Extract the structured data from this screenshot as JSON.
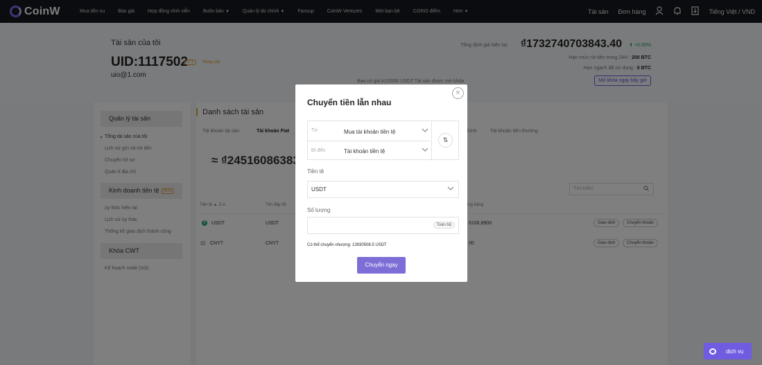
{
  "brand": {
    "name": "CoinW"
  },
  "nav": {
    "items": [
      {
        "label": "Mua tiền xu",
        "caret": false
      },
      {
        "label": "Báo giá",
        "caret": false
      },
      {
        "label": "Hợp đồng vĩnh viễn",
        "caret": false
      },
      {
        "label": "Buôn bán",
        "caret": true
      },
      {
        "label": "Quản lý tài chính",
        "caret": true
      },
      {
        "label": "Fansup",
        "caret": false
      },
      {
        "label": "CoinW Ventures",
        "caret": false
      },
      {
        "label": "Mời bạn bè",
        "caret": false
      },
      {
        "label": "COINS điểm",
        "caret": false
      },
      {
        "label": "Hơn",
        "caret": true
      }
    ],
    "right": {
      "assets": "Tài sản",
      "orders": "Đơn hàng",
      "language": "Tiếng Việt / VND"
    }
  },
  "header": {
    "title": "Tài sản của tôi",
    "uid": "UID:1117502",
    "vip": "V 1",
    "upgrade": "Nâng cấp",
    "email": "uio@1.com",
    "total_label": "Tổng định giá hiện tại:",
    "total_value": "₫1732740703843.40",
    "change": "+0.00%",
    "withdraw_limit_label": "Hạn mức rút tiền trong 24H :",
    "withdraw_limit_value": "200 BTC",
    "used_label": "Hạn ngạch đã sử dụng :",
    "used_value": "0 BTC",
    "unlock_text": "Bạn có giá trị10000 USDT Tài sản được mở khóa",
    "unlock_button": "Mở khóa ngay bây giờ"
  },
  "sidebar": {
    "asset_mgmt": "Quản lý tài sản",
    "asset_items": [
      "Tổng tài sản của tôi",
      "Lịch sử gửi và rút tiền",
      "Chuyển hồ sơ",
      "Quản lí địa chỉ"
    ],
    "copy_trading": "Kinh doanh tiền tệ",
    "copy_tag": "NEW",
    "copy_items": [
      "ủy thác hiện tại",
      "Lịch sử ủy thác",
      "Thống kê giao dịch thành công"
    ],
    "lock": "Khóa CWT",
    "lock_items": [
      "Kế hoạch node (nút)"
    ]
  },
  "main": {
    "title": "Danh sách tài sản",
    "tabs": [
      "Tài khoản tài sản",
      "Tài khoản Fiat",
      "hính",
      "Tài khoản tiền thường"
    ],
    "big_value": "≈ ₫24516086383",
    "search_placeholder": "Tìm kiếm",
    "headers": [
      "Tiền tệ ▲ Z-A",
      "Tên đầy đủ",
      "ông băng"
    ],
    "rows": [
      {
        "coin": "USDT",
        "name": "USDT",
        "frozen": "6106,8900",
        "a1": "Giao dịch",
        "a2": "Chuyển khoản"
      },
      {
        "coin": "CNYT",
        "name": "CNYT",
        "frozen": "00",
        "a1": "Giao dịch",
        "a2": "Chuyển khoản"
      }
    ]
  },
  "modal": {
    "title": "Chuyển tiền lẫn nhau",
    "from_label": "Từ",
    "from_value": "Mua tài khoản tiền tệ",
    "to_label": "Đi đến",
    "to_value": "Tài khoản tiền tệ",
    "currency_label": "Tiền tệ",
    "currency_value": "USDT",
    "amount_label": "Số lượng",
    "amount_value": "",
    "all_button": "Toàn bộ",
    "available": "Có thể chuyển nhượng: 13930508.5 USDT",
    "submit": "Chuyển ngay"
  },
  "chat": {
    "label": "dịch vụ"
  }
}
